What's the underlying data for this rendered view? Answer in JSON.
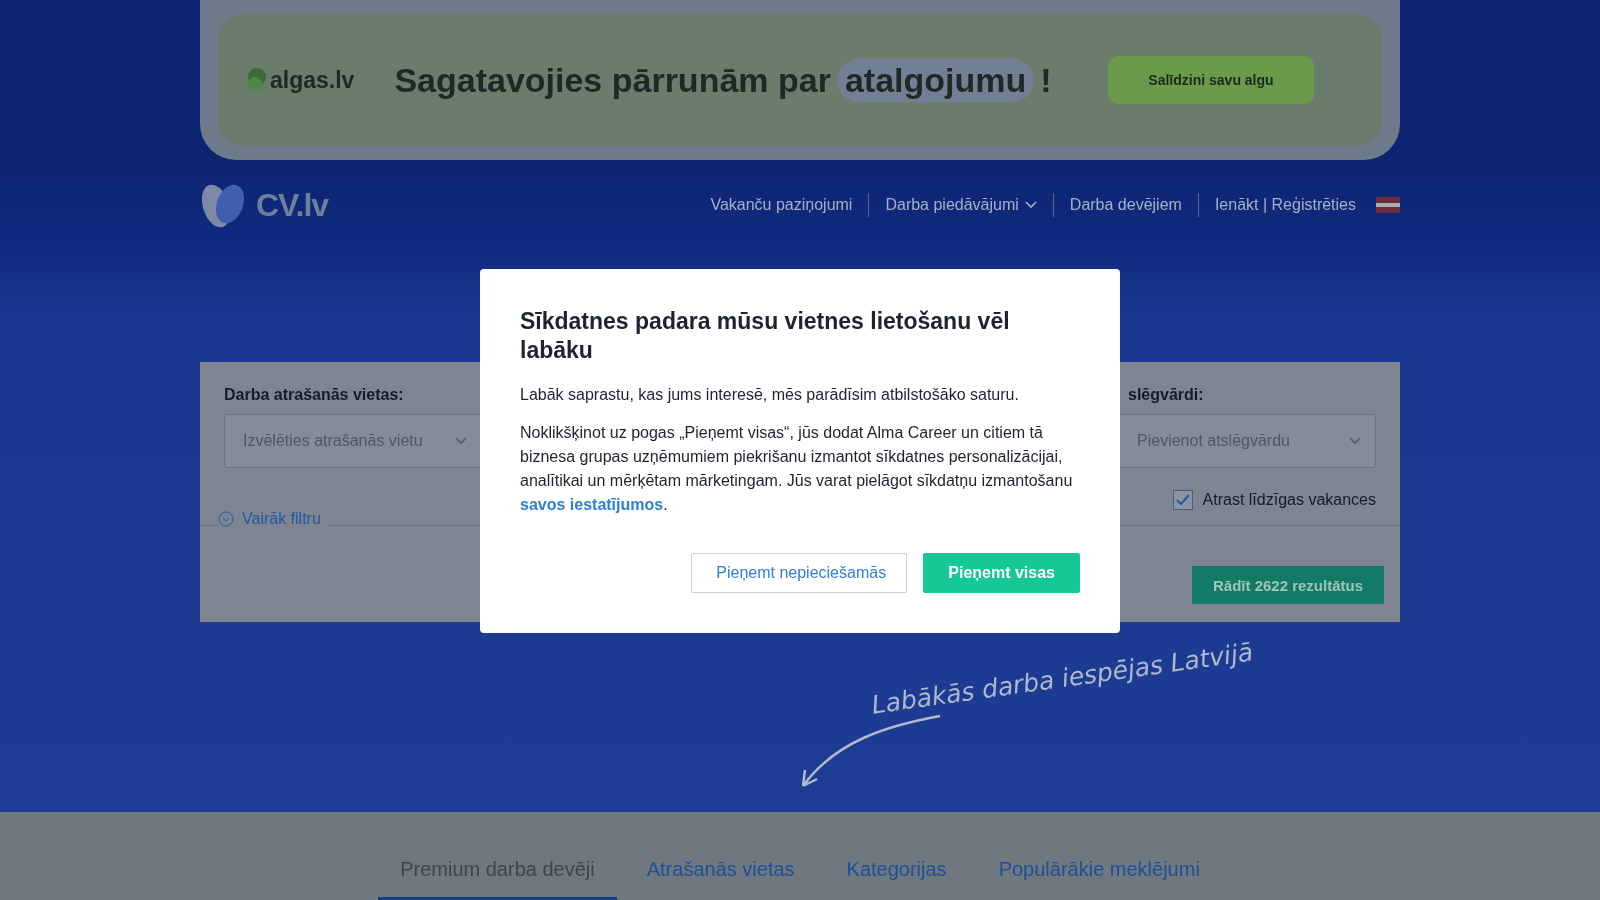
{
  "banner": {
    "logo": "algas.lv",
    "headline": "Sagatavojies pārrunām par",
    "highlight": "atalgojumu",
    "mark": "!",
    "button": "Salīdzini savu algu"
  },
  "header": {
    "logo": "CV.lv",
    "nav": [
      {
        "label": "Vakanču paziņojumi",
        "kind": "link"
      },
      {
        "label": "Darba piedāvājumi",
        "kind": "dropdown"
      },
      {
        "label": "Darba devējiem",
        "kind": "link"
      },
      {
        "label": "Ienākt | Reģistrēties",
        "kind": "link"
      }
    ]
  },
  "search": {
    "location_label": "Darba atrašanās vietas:",
    "location_placeholder": "Izvēlēties atrašanās vietu",
    "keywords_label": "slēgvārdi:",
    "keywords_placeholder": "Pievienot atslēgvārdu",
    "similar": {
      "label": "Atrast līdzīgas vakances",
      "checked": true
    },
    "more_filters": "Vairāk filtru",
    "results_button": "Rādīt 2622 rezultātus"
  },
  "tagline": "Labākās darba iespējas Latvijā",
  "tabs": [
    {
      "label": "Premium darba devēji",
      "selected": true
    },
    {
      "label": "Atrašanās vietas",
      "selected": false
    },
    {
      "label": "Kategorijas",
      "selected": false
    },
    {
      "label": "Populārākie meklējumi",
      "selected": false
    }
  ],
  "cookie_dialog": {
    "title": "Sīkdatnes padara mūsu vietnes lietošanu vēl labāku",
    "intro": "Labāk saprastu, kas jums interesē, mēs parādīsim atbilstošāko saturu.",
    "body": "Noklikšķinot uz pogas „Pieņemt visas“, jūs dodat Alma Career un citiem tā biznesa grupas uzņēmumiem piekrišanu izmantot sīkdatnes personalizācijai, analītikai un mērķētam mārketingam. Jūs varat pielāgot sīkdatņu izmantošanu",
    "link": "savos iestatījumos",
    "end": ".",
    "buttons": [
      {
        "label": "Pieņemt nepieciešamās",
        "kind": "secondary"
      },
      {
        "label": "Pieņemt visas",
        "kind": "primary"
      }
    ]
  }
}
